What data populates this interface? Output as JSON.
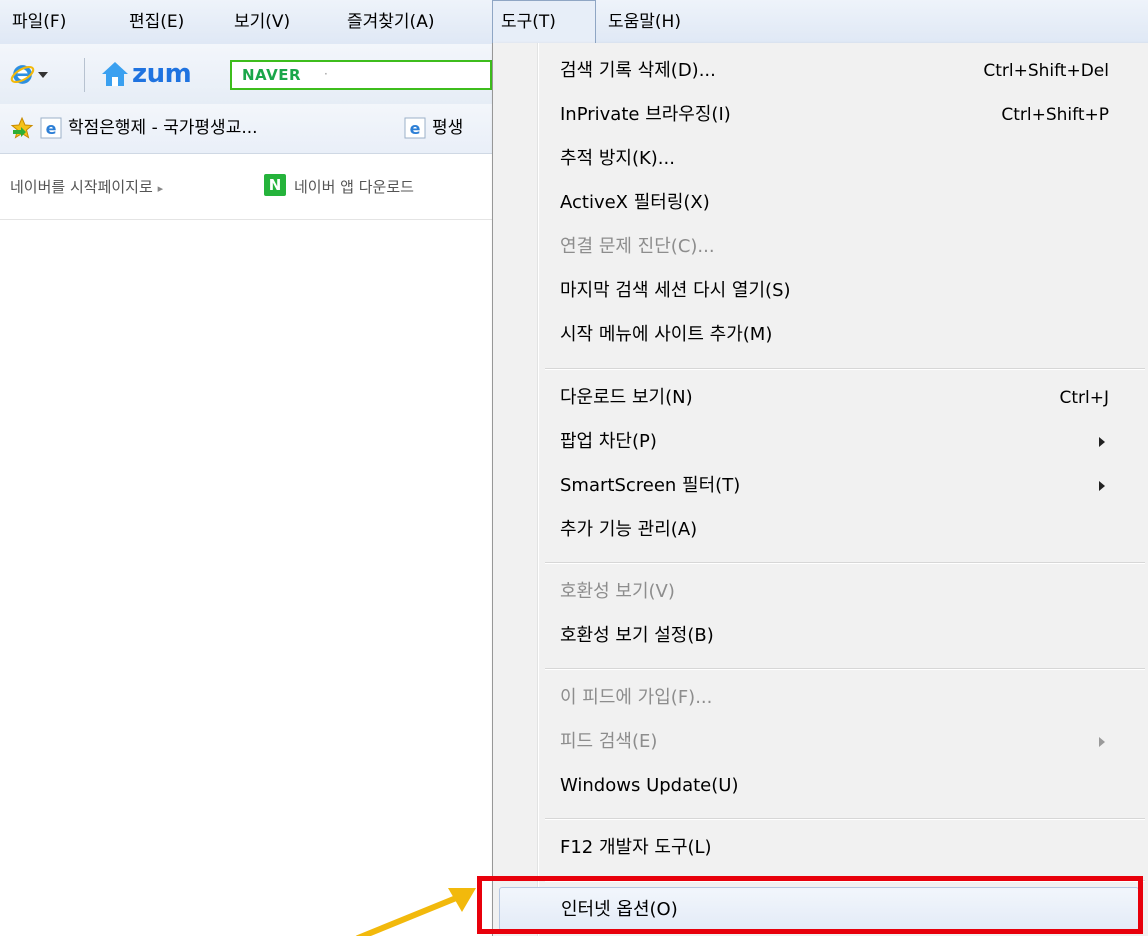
{
  "menubar": {
    "items": [
      {
        "label": "파일(F)"
      },
      {
        "label": "편집(E)"
      },
      {
        "label": "보기(V)"
      },
      {
        "label": "즐겨찾기(A)"
      },
      {
        "label": "도구(T)"
      },
      {
        "label": "도움말(H)"
      }
    ]
  },
  "command_bar": {
    "home_label": "zum",
    "search_provider": "NAVER",
    "search_provider_chevron": "·"
  },
  "favorites_bar": {
    "items": [
      {
        "label": "학점은행제 - 국가평생교..."
      },
      {
        "label": "평생"
      }
    ]
  },
  "info_strip": {
    "set_homepage": "네이버를 시작페이지로",
    "set_homepage_arrow": "▸",
    "naver_badge": "N",
    "app_download": "네이버 앱 다운로드"
  },
  "tools_menu": {
    "items": [
      {
        "label": "검색 기록 삭제(D)...",
        "shortcut": "Ctrl+Shift+Del",
        "disabled": false
      },
      {
        "label": "InPrivate 브라우징(I)",
        "shortcut": "Ctrl+Shift+P",
        "disabled": false
      },
      {
        "label": "추적 방지(K)...",
        "disabled": false
      },
      {
        "label": "ActiveX 필터링(X)",
        "disabled": false
      },
      {
        "label": "연결 문제 진단(C)...",
        "disabled": true
      },
      {
        "label": "마지막 검색 세션 다시 열기(S)",
        "disabled": false
      },
      {
        "label": "시작 메뉴에 사이트 추가(M)",
        "disabled": false
      },
      {
        "label": "다운로드 보기(N)",
        "shortcut": "Ctrl+J",
        "disabled": false
      },
      {
        "label": "팝업 차단(P)",
        "submenu": true,
        "disabled": false
      },
      {
        "label": "SmartScreen 필터(T)",
        "submenu": true,
        "disabled": false
      },
      {
        "label": "추가 기능 관리(A)",
        "disabled": false
      },
      {
        "label": "호환성 보기(V)",
        "disabled": true
      },
      {
        "label": "호환성 보기 설정(B)",
        "disabled": false
      },
      {
        "label": "이 피드에 가입(F)...",
        "disabled": true
      },
      {
        "label": "피드 검색(E)",
        "submenu": true,
        "disabled": true
      },
      {
        "label": "Windows Update(U)",
        "disabled": false
      },
      {
        "label": "F12 개발자 도구(L)",
        "disabled": false
      },
      {
        "label": "인터넷 옵션(O)",
        "disabled": false,
        "highlighted": true
      }
    ]
  },
  "annotation": {
    "box_color": "#e8000b",
    "arrow_color": "#f2b90c",
    "target": "인터넷 옵션(O)"
  },
  "colors": {
    "naver_green": "#3dbd1c",
    "zum_blue": "#1f73e0",
    "disabled_text": "#8d8d8d"
  }
}
